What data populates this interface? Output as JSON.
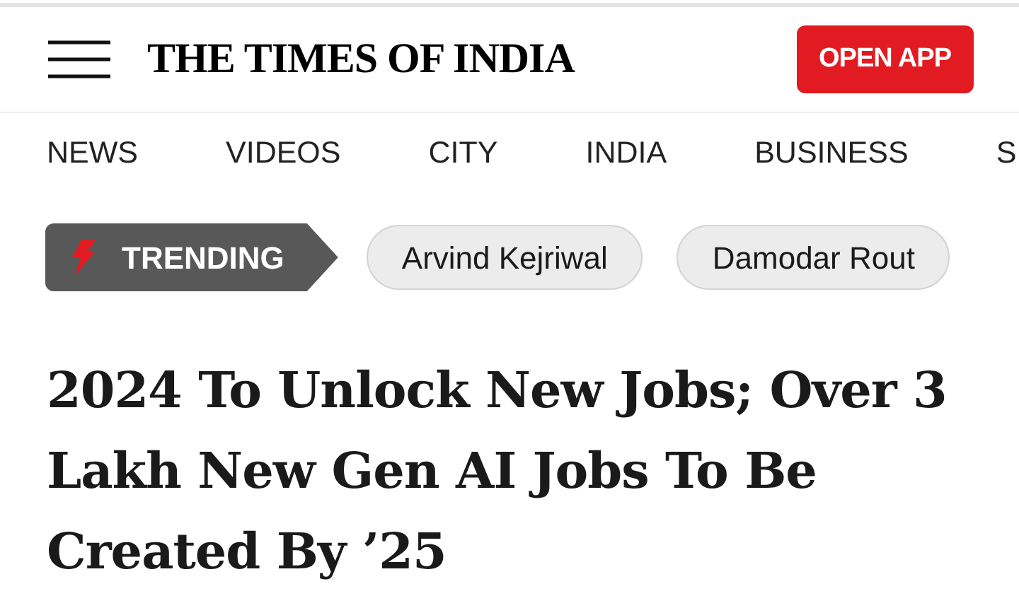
{
  "header": {
    "logo": "THE TIMES OF INDIA",
    "open_app_button": "OPEN APP"
  },
  "nav": [
    {
      "label": "NEWS"
    },
    {
      "label": "VIDEOS"
    },
    {
      "label": "CITY"
    },
    {
      "label": "INDIA"
    },
    {
      "label": "BUSINESS"
    },
    {
      "label": "S"
    }
  ],
  "trending": {
    "label": "TRENDING",
    "topics": [
      "Arvind Kejriwal",
      "Damodar Rout"
    ]
  },
  "headline": "2024 To Unlock New Jobs; Over 3 Lakh New Gen AI Jobs To Be Created By ’25"
}
